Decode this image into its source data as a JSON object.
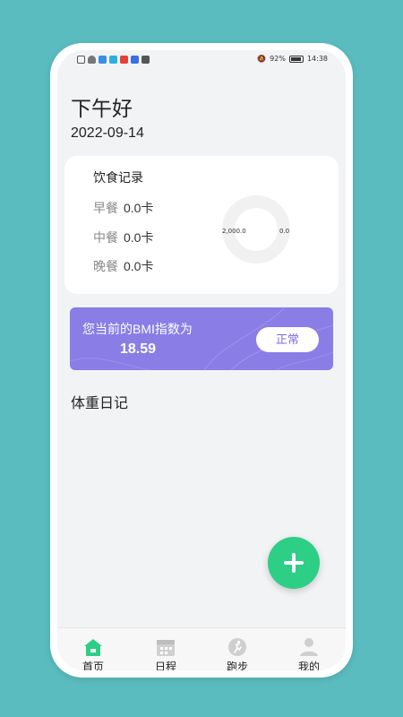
{
  "status_bar": {
    "battery": "92%",
    "time": "14:38"
  },
  "greeting": "下午好",
  "date": "2022-09-14",
  "diet": {
    "title": "饮食记录",
    "meals": [
      {
        "label": "早餐",
        "value": "0.0卡"
      },
      {
        "label": "中餐",
        "value": "0.0卡"
      },
      {
        "label": "晚餐",
        "value": "0.0卡"
      }
    ],
    "chart_left_label": "2,000.0",
    "chart_right_label": "0.0"
  },
  "bmi": {
    "label": "您当前的BMI指数为",
    "value": "18.59",
    "status": "正常"
  },
  "weight_diary_title": "体重日记",
  "tabs": [
    {
      "label": "首页",
      "icon": "home-icon",
      "active": true
    },
    {
      "label": "日程",
      "icon": "calendar-icon",
      "active": false
    },
    {
      "label": "跑步",
      "icon": "run-icon",
      "active": false
    },
    {
      "label": "我的",
      "icon": "user-icon",
      "active": false
    }
  ],
  "colors": {
    "background": "#5bbcbf",
    "accent_green": "#2dcf86",
    "bmi_purple": "#8a7de6"
  }
}
